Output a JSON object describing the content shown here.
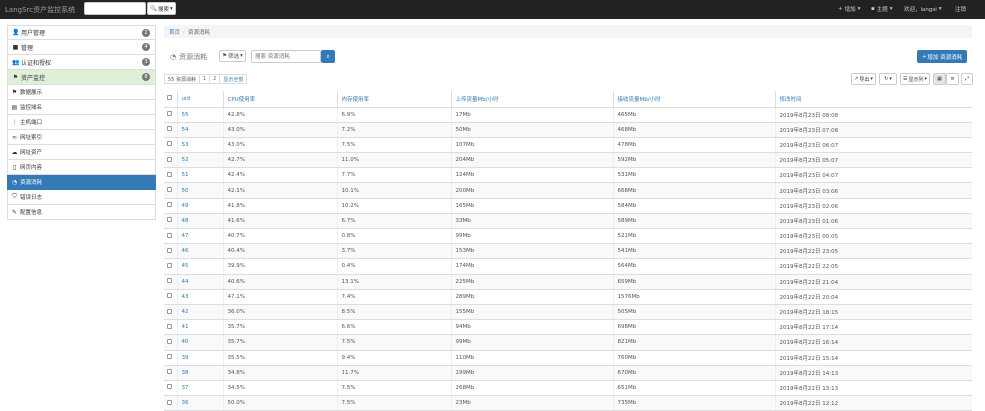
{
  "app": {
    "brand": "LangSrc资产监控系统"
  },
  "top_search": {
    "button_label": "搜索"
  },
  "top_nav": {
    "add": "增加",
    "theme": "主题",
    "welcome": "欢迎，langsi",
    "logout": "注销"
  },
  "sidebar": {
    "items": [
      {
        "label": "用户管理",
        "badge": "2",
        "icon": "user-icon"
      },
      {
        "label": "管理",
        "badge": "4",
        "icon": "briefcase-icon"
      },
      {
        "label": "认证和授权",
        "badge": "3",
        "icon": "group-icon"
      },
      {
        "label": "资产监控",
        "badge": "8",
        "icon": "flag-icon"
      }
    ],
    "sub_items": [
      {
        "label": "数据展示",
        "icon": "flag-icon"
      },
      {
        "label": "监控域名",
        "icon": "server-icon"
      },
      {
        "label": "主机端口",
        "icon": "signal-icon"
      },
      {
        "label": "网址索引",
        "icon": "link-icon"
      },
      {
        "label": "网址资产",
        "icon": "cloud-icon"
      },
      {
        "label": "网页内容",
        "icon": "file-icon"
      },
      {
        "label": "资源消耗",
        "icon": "gauge-icon"
      },
      {
        "label": "错误日志",
        "icon": "shield-icon"
      },
      {
        "label": "配置信息",
        "icon": "wrench-icon"
      }
    ]
  },
  "breadcrumb": {
    "home": "首页",
    "current": "资源消耗"
  },
  "toolbar": {
    "title": "资源消耗",
    "filter_label": "筛选",
    "search_placeholder": "搜索 资源消耗",
    "add_label": "增加 资源消耗",
    "export_label": "导出",
    "columns_label": "显示列"
  },
  "tabs": {
    "count": "55 资源消耗",
    "page1": "1",
    "page2": "2",
    "show_all": "显示全部"
  },
  "table": {
    "headers": {
      "uid": "uid",
      "cpu": "CPU使用率",
      "mem": "内存使用率",
      "up": "上传流量Mb/小时",
      "down": "接收流量Mb/小时",
      "time": "修改时间"
    },
    "rows": [
      {
        "uid": "55",
        "cpu": "42.8%",
        "mem": "6.9%",
        "up": "17Mb",
        "down": "465Mb",
        "time": "2019年8月23日 08:08"
      },
      {
        "uid": "54",
        "cpu": "43.0%",
        "mem": "7.2%",
        "up": "50Mb",
        "down": "468Mb",
        "time": "2019年8月23日 07:08"
      },
      {
        "uid": "53",
        "cpu": "43.0%",
        "mem": "7.5%",
        "up": "107Mb",
        "down": "478Mb",
        "time": "2019年8月23日 06:07"
      },
      {
        "uid": "52",
        "cpu": "42.7%",
        "mem": "11.0%",
        "up": "204Mb",
        "down": "592Mb",
        "time": "2019年8月23日 05:07"
      },
      {
        "uid": "51",
        "cpu": "42.4%",
        "mem": "7.7%",
        "up": "124Mb",
        "down": "531Mb",
        "time": "2019年8月23日 04:07"
      },
      {
        "uid": "50",
        "cpu": "42.1%",
        "mem": "10.1%",
        "up": "200Mb",
        "down": "668Mb",
        "time": "2019年8月23日 03:06"
      },
      {
        "uid": "49",
        "cpu": "41.8%",
        "mem": "10.2%",
        "up": "165Mb",
        "down": "584Mb",
        "time": "2019年8月23日 02:06"
      },
      {
        "uid": "48",
        "cpu": "41.6%",
        "mem": "6.7%",
        "up": "33Mb",
        "down": "589Mb",
        "time": "2019年8月23日 01:06"
      },
      {
        "uid": "47",
        "cpu": "40.7%",
        "mem": "0.8%",
        "up": "99Mb",
        "down": "521Mb",
        "time": "2019年8月23日 00:05"
      },
      {
        "uid": "46",
        "cpu": "40.4%",
        "mem": "3.7%",
        "up": "153Mb",
        "down": "541Mb",
        "time": "2019年8月22日 23:05"
      },
      {
        "uid": "45",
        "cpu": "39.9%",
        "mem": "0.4%",
        "up": "174Mb",
        "down": "564Mb",
        "time": "2019年8月22日 22:05"
      },
      {
        "uid": "44",
        "cpu": "40.6%",
        "mem": "13.1%",
        "up": "225Mb",
        "down": "659Mb",
        "time": "2019年8月22日 21:04"
      },
      {
        "uid": "43",
        "cpu": "47.1%",
        "mem": "7.4%",
        "up": "289Mb",
        "down": "1576Mb",
        "time": "2019年8月22日 20:04"
      },
      {
        "uid": "42",
        "cpu": "36.0%",
        "mem": "8.5%",
        "up": "155Mb",
        "down": "505Mb",
        "time": "2019年8月22日 18:15"
      },
      {
        "uid": "41",
        "cpu": "35.7%",
        "mem": "6.6%",
        "up": "94Mb",
        "down": "698Mb",
        "time": "2019年8月22日 17:14"
      },
      {
        "uid": "40",
        "cpu": "35.7%",
        "mem": "7.5%",
        "up": "99Mb",
        "down": "821Mb",
        "time": "2019年8月22日 16:14"
      },
      {
        "uid": "39",
        "cpu": "35.5%",
        "mem": "9.4%",
        "up": "110Mb",
        "down": "760Mb",
        "time": "2019年8月22日 15:14"
      },
      {
        "uid": "38",
        "cpu": "34.8%",
        "mem": "11.7%",
        "up": "199Mb",
        "down": "670Mb",
        "time": "2019年8月22日 14:13"
      },
      {
        "uid": "37",
        "cpu": "34.5%",
        "mem": "7.5%",
        "up": "268Mb",
        "down": "651Mb",
        "time": "2019年8月22日 13:13"
      },
      {
        "uid": "36",
        "cpu": "50.0%",
        "mem": "7.5%",
        "up": "23Mb",
        "down": "735Mb",
        "time": "2019年8月22日 12:12"
      }
    ]
  }
}
